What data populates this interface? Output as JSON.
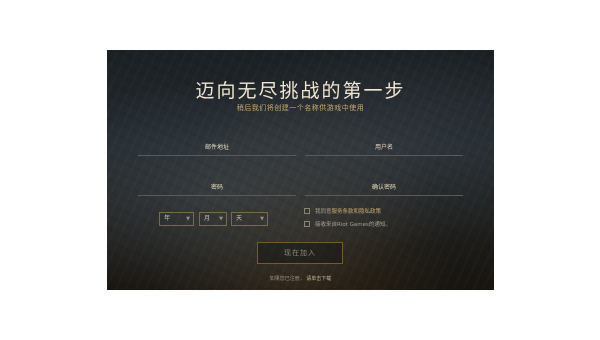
{
  "form": {
    "title": "迈向无尽挑战的第一步",
    "subtitle": "稍后我们将创建一个名称供游戏中使用",
    "email_label": "邮件地址",
    "username_label": "用户名",
    "password_label": "密码",
    "confirm_label": "确认密码",
    "birthdate": {
      "year": "年",
      "month": "月",
      "day": "天"
    },
    "checkbox_terms_prefix": "我同意",
    "checkbox_terms_link": "服务条款和隐私政策",
    "checkbox_news": "接收来自Riot Games的通知。",
    "submit_label": "现在加入",
    "login_prompt": "如果您已注册，",
    "login_link": "请单击下载"
  },
  "icons": {
    "select_chevron": "chevron-down-icon"
  },
  "colors": {
    "gold": "#c8aa6e",
    "title": "#f0e6d2",
    "border_gold": "#785a28",
    "panel_bg": "#1e2428"
  }
}
